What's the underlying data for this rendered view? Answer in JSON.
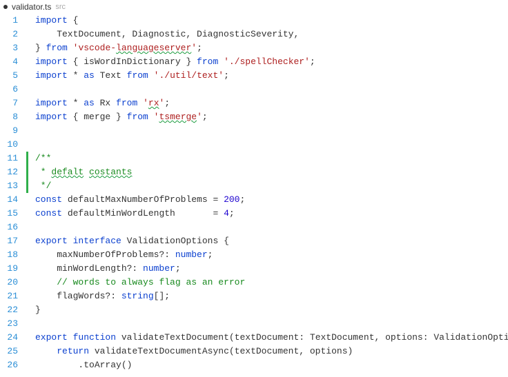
{
  "tab": {
    "dirty": true,
    "title": "validator.ts",
    "path": "src"
  },
  "lines": [
    {
      "n": 1,
      "diff": false,
      "html": "<span class='kw'>import</span> {"
    },
    {
      "n": 2,
      "diff": false,
      "html": "    TextDocument, Diagnostic, DiagnosticSeverity,"
    },
    {
      "n": 3,
      "diff": false,
      "html": "} <span class='kw'>from</span> <span class='str'>'vscode-<span class='squiggle'>languageserver</span>'</span>;"
    },
    {
      "n": 4,
      "diff": false,
      "html": "<span class='kw'>import</span> { isWordInDictionary } <span class='kw'>from</span> <span class='str'>'./spellChecker'</span>;"
    },
    {
      "n": 5,
      "diff": false,
      "html": "<span class='kw'>import</span> * <span class='kw'>as</span> Text <span class='kw'>from</span> <span class='str'>'./util/text'</span>;"
    },
    {
      "n": 6,
      "diff": false,
      "html": ""
    },
    {
      "n": 7,
      "diff": false,
      "html": "<span class='kw'>import</span> * <span class='kw'>as</span> Rx <span class='kw'>from</span> <span class='str'>'<span class='squiggle'>rx</span>'</span>;"
    },
    {
      "n": 8,
      "diff": false,
      "html": "<span class='kw'>import</span> { merge } <span class='kw'>from</span> <span class='str'>'<span class='squiggle'>tsmerge</span>'</span>;"
    },
    {
      "n": 9,
      "diff": false,
      "html": ""
    },
    {
      "n": 10,
      "diff": false,
      "html": ""
    },
    {
      "n": 11,
      "diff": true,
      "html": "<span class='cmt'>/**</span>"
    },
    {
      "n": 12,
      "diff": true,
      "html": "<span class='cmt'> * <span class='squiggle'>defalt</span> <span class='squiggle'>costants</span></span>"
    },
    {
      "n": 13,
      "diff": true,
      "html": "<span class='cmt'> */</span>"
    },
    {
      "n": 14,
      "diff": false,
      "html": "<span class='kw'>const</span> defaultMaxNumberOfProblems = <span class='num'>200</span>;"
    },
    {
      "n": 15,
      "diff": false,
      "html": "<span class='kw'>const</span> defaultMinWordLength       = <span class='num'>4</span>;"
    },
    {
      "n": 16,
      "diff": false,
      "html": ""
    },
    {
      "n": 17,
      "diff": false,
      "html": "<span class='kw'>export</span> <span class='kw'>interface</span> ValidationOptions {"
    },
    {
      "n": 18,
      "diff": false,
      "html": "    maxNumberOfProblems?: <span class='kw'>number</span>;"
    },
    {
      "n": 19,
      "diff": false,
      "html": "    minWordLength?: <span class='kw'>number</span>;"
    },
    {
      "n": 20,
      "diff": false,
      "html": "    <span class='cmt'>// words to always flag as an error</span>"
    },
    {
      "n": 21,
      "diff": false,
      "html": "    flagWords?: <span class='kw'>string</span>[];"
    },
    {
      "n": 22,
      "diff": false,
      "html": "}"
    },
    {
      "n": 23,
      "diff": false,
      "html": ""
    },
    {
      "n": 24,
      "diff": false,
      "html": "<span class='kw'>export</span> <span class='kw'>function</span> validateTextDocument(textDocument: TextDocument, options: ValidationOpti"
    },
    {
      "n": 25,
      "diff": false,
      "html": "    <span class='kw'>return</span> validateTextDocumentAsync(textDocument, options)"
    },
    {
      "n": 26,
      "diff": false,
      "html": "        .toArray()"
    }
  ]
}
